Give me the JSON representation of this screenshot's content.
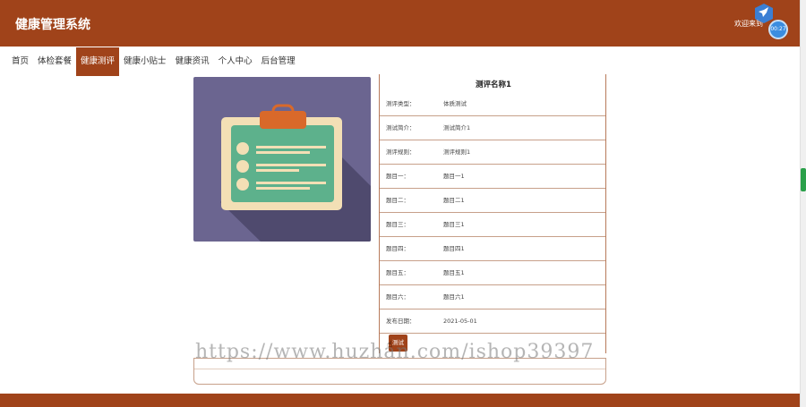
{
  "header": {
    "app_title": "健康管理系统",
    "welcome_text": "欢迎来到",
    "timer_text": "00:27"
  },
  "nav": {
    "items": [
      {
        "label": "首页",
        "active": false
      },
      {
        "label": "体检套餐",
        "active": false
      },
      {
        "label": "健康测评",
        "active": true
      },
      {
        "label": "健康小贴士",
        "active": false
      },
      {
        "label": "健康资讯",
        "active": false
      },
      {
        "label": "个人中心",
        "active": false
      },
      {
        "label": "后台管理",
        "active": false
      }
    ]
  },
  "detail": {
    "title": "测评名称1",
    "rows": [
      {
        "label": "测评类型：",
        "value": "体质测试"
      },
      {
        "label": "测试简介：",
        "value": "测试简介1"
      },
      {
        "label": "测评规则：",
        "value": "测评规则1"
      },
      {
        "label": "题目一：",
        "value": "题目一1"
      },
      {
        "label": "题目二：",
        "value": "题目二1"
      },
      {
        "label": "题目三：",
        "value": "题目三1"
      },
      {
        "label": "题目四：",
        "value": "题目四1"
      },
      {
        "label": "题目五：",
        "value": "题目五1"
      },
      {
        "label": "题目六：",
        "value": "题目六1"
      },
      {
        "label": "发布日期：",
        "value": "2021-05-01"
      }
    ],
    "test_button_label": "测试"
  },
  "watermark": "https://www.huzhan.com/ishop39397",
  "colors": {
    "brand": "#a0431a",
    "image_bg": "#6b6590",
    "clipboard_board": "#f3dfb5",
    "clipboard_paper": "#5db18c",
    "clip": "#d9692a"
  },
  "icons": {
    "product_image": "clipboard-icon",
    "floating": "bird-icon"
  }
}
